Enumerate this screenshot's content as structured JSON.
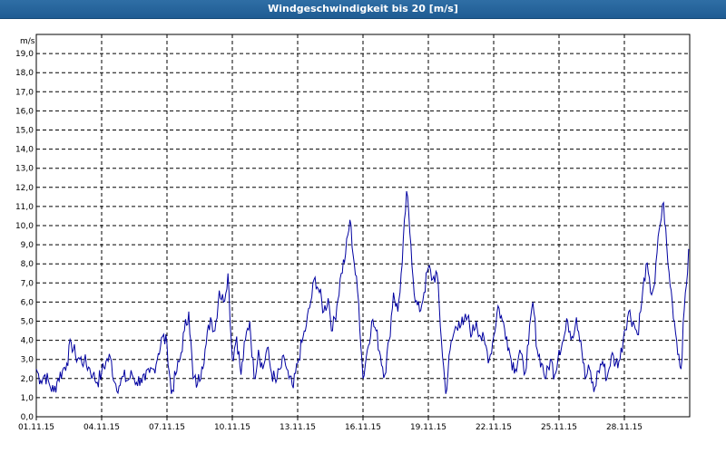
{
  "window": {
    "title": "Windgeschwindigkeit bis 20 [m/s]"
  },
  "colors": {
    "titlebar": "#1f5c93",
    "line": "#0000a0",
    "grid": "#000000"
  },
  "chart_data": {
    "type": "line",
    "title": "Windgeschwindigkeit bis 20 [m/s]",
    "ylabel": "m/s",
    "xlabel": "",
    "ylim": [
      0,
      20
    ],
    "yticks": [
      "0,0",
      "1,0",
      "2,0",
      "3,0",
      "4,0",
      "5,0",
      "6,0",
      "7,0",
      "8,0",
      "9,0",
      "10,0",
      "11,0",
      "12,0",
      "13,0",
      "14,0",
      "15,0",
      "16,0",
      "17,0",
      "18,0",
      "19,0"
    ],
    "xlim": [
      "01.11.15",
      "01.12.15"
    ],
    "xticks": [
      "01.11.15",
      "04.11.15",
      "07.11.15",
      "10.11.15",
      "13.11.15",
      "16.11.15",
      "19.11.15",
      "22.11.15",
      "25.11.15",
      "28.11.15"
    ],
    "grid": true,
    "series": [
      {
        "x_days": [
          0,
          0.2,
          0.4,
          0.6,
          0.8,
          1.0,
          1.2,
          1.4,
          1.6,
          1.8,
          2.0,
          2.2,
          2.4,
          2.6,
          2.8,
          3.0,
          3.2,
          3.4,
          3.6,
          3.8,
          4.0,
          4.2,
          4.4,
          4.6,
          4.8,
          5.0,
          5.2,
          5.4,
          5.6,
          5.8,
          6.0,
          6.2,
          6.4,
          6.6,
          6.8,
          7.0,
          7.2,
          7.4,
          7.6,
          7.8,
          8.0,
          8.2,
          8.4,
          8.6,
          8.8,
          9.0,
          9.2,
          9.4,
          9.6,
          9.8,
          10.0,
          10.2,
          10.4,
          10.6,
          10.8,
          11.0,
          11.2,
          11.4,
          11.6,
          11.8,
          12.0,
          12.2,
          12.4,
          12.6,
          12.8,
          13.0,
          13.2,
          13.4,
          13.6,
          13.8,
          14.0,
          14.2,
          14.4,
          14.6,
          14.8,
          15.0,
          15.2,
          15.4,
          15.6,
          15.8,
          16.0,
          16.2,
          16.4,
          16.6,
          16.8,
          17.0,
          17.2,
          17.4,
          17.6,
          17.8,
          18.0,
          18.2,
          18.4,
          18.6,
          18.8,
          19.0,
          19.2,
          19.4,
          19.6,
          19.8,
          20.0,
          20.2,
          20.4,
          20.6,
          20.8,
          21.0,
          21.2,
          21.4,
          21.6,
          21.8,
          22.0,
          22.2,
          22.4,
          22.6,
          22.8,
          23.0,
          23.2,
          23.4,
          23.6,
          23.8,
          24.0,
          24.2,
          24.4,
          24.6,
          24.8,
          25.0,
          25.2,
          25.4,
          25.6,
          25.8,
          26.0,
          26.2,
          26.4,
          26.6,
          26.8,
          27.0,
          27.2,
          27.4,
          27.6,
          27.8,
          28.0,
          28.2,
          28.4,
          28.6,
          28.8,
          29.0,
          29.2,
          29.4,
          29.6,
          29.8,
          30.0
        ],
        "values": [
          2.5,
          1.9,
          2.2,
          1.7,
          1.3,
          2.0,
          2.4,
          2.8,
          3.9,
          3.2,
          3.0,
          2.9,
          2.6,
          2.2,
          1.8,
          2.3,
          2.9,
          3.1,
          1.8,
          1.6,
          2.1,
          1.9,
          2.2,
          1.8,
          2.0,
          1.9,
          2.3,
          2.5,
          3.3,
          4.2,
          3.8,
          1.2,
          2.2,
          3.0,
          4.5,
          5.5,
          2.0,
          1.7,
          2.6,
          3.8,
          5.2,
          4.5,
          6.6,
          6.0,
          7.5,
          3.0,
          4.2,
          2.2,
          4.0,
          5.0,
          2.0,
          3.5,
          2.5,
          3.6,
          2.3,
          1.8,
          2.5,
          3.0,
          2.0,
          1.5,
          2.8,
          3.9,
          4.8,
          6.0,
          7.3,
          6.5,
          5.5,
          6.2,
          4.5,
          5.8,
          7.5,
          8.5,
          10.3,
          8.0,
          6.0,
          2.0,
          3.5,
          5.0,
          4.5,
          3.2,
          2.2,
          4.0,
          6.5,
          5.5,
          8.0,
          11.8,
          9.0,
          6.0,
          5.5,
          6.5,
          7.8,
          7.2,
          7.5,
          4.0,
          1.2,
          3.5,
          4.5,
          5.0,
          4.8,
          5.2,
          4.3,
          5.0,
          4.2,
          3.8,
          3.0,
          4.2,
          5.8,
          5.0,
          4.2,
          3.0,
          2.5,
          3.5,
          2.2,
          3.8,
          6.0,
          3.5,
          2.8,
          2.0,
          3.0,
          2.2,
          3.5,
          4.0,
          5.0,
          4.2,
          5.2,
          4.0,
          2.0,
          2.5,
          1.3,
          2.4,
          2.9,
          2.0,
          3.2,
          2.8,
          3.0,
          4.5,
          5.5,
          5.0,
          4.3,
          6.0,
          8.0,
          6.5,
          7.0,
          9.8,
          11.2,
          8.0,
          6.0,
          4.0,
          2.5,
          6.5,
          9.0,
          10.8
        ]
      }
    ]
  }
}
